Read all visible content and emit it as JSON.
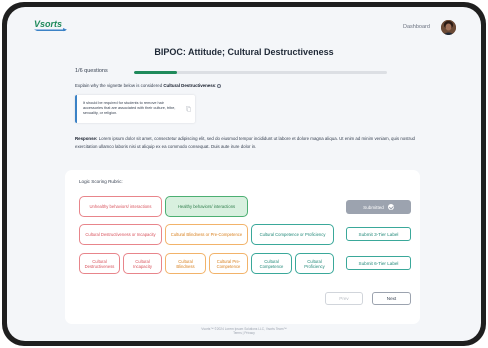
{
  "header": {
    "logo_text": "Vsorts",
    "dashboard_label": "Dashboard"
  },
  "page": {
    "title": "BIPOC: Attitude; Cultural Destructiveness",
    "question_count": "1/6 questions",
    "progress_fraction": 0.17
  },
  "prompt": {
    "text_before": "Explain why the vignette below is considered ",
    "text_bold": "Cultural Destructiveness",
    "text_after": ":"
  },
  "vignette": {
    "text": "It should be required for students to remove hair accessories that are associated with their culture, tribe, sexuality, or religion."
  },
  "response": {
    "label": "Response:",
    "text": "Lorem ipsum dolor sit amet, consectetur adipiscing elit, sed do eiusmod tempor incididunt ut labore et dolore magna aliqua. Ut enim ad minim veniam, quis nostrud exercitation ullamco laboris nisi ut aliquip ex ea commodo consequat. Duis aute irure dolor in."
  },
  "rubric": {
    "title": "Logic Scoring Rubric:",
    "row1": [
      "Unhealthy behaviors/ interactions",
      "Healthy behaviors/ interactions"
    ],
    "row2": [
      "Cultural Destructiveness or Incapacity",
      "Cultural Blindness or Pre-Competence",
      "Cultural Competence or Proficiency"
    ],
    "row3": [
      "Cultural Destructiveness",
      "Cultural Incapacity",
      "Cultural Blindness",
      "Cultural Pre-Competence",
      "Cultural Competence",
      "Cultural Proficiency"
    ]
  },
  "buttons": {
    "submitted": "Submitted",
    "submit_3tier": "Submit 3-Tier Label",
    "submit_6tier": "Submit 6-Tier Label",
    "prev": "Prev",
    "next": "Next"
  },
  "footer": {
    "line1": "Vsorts™ ©2024 Lorem Ipsum Solutions LLC, Vsorts Team™",
    "line2": "Terms | Privacy"
  },
  "colors": {
    "accent_green": "#1f8a5b",
    "unhealthy_red": "#d9535d",
    "mid_orange": "#d8801f",
    "healthy_teal": "#208878",
    "vignette_blue": "#3b82c6"
  }
}
